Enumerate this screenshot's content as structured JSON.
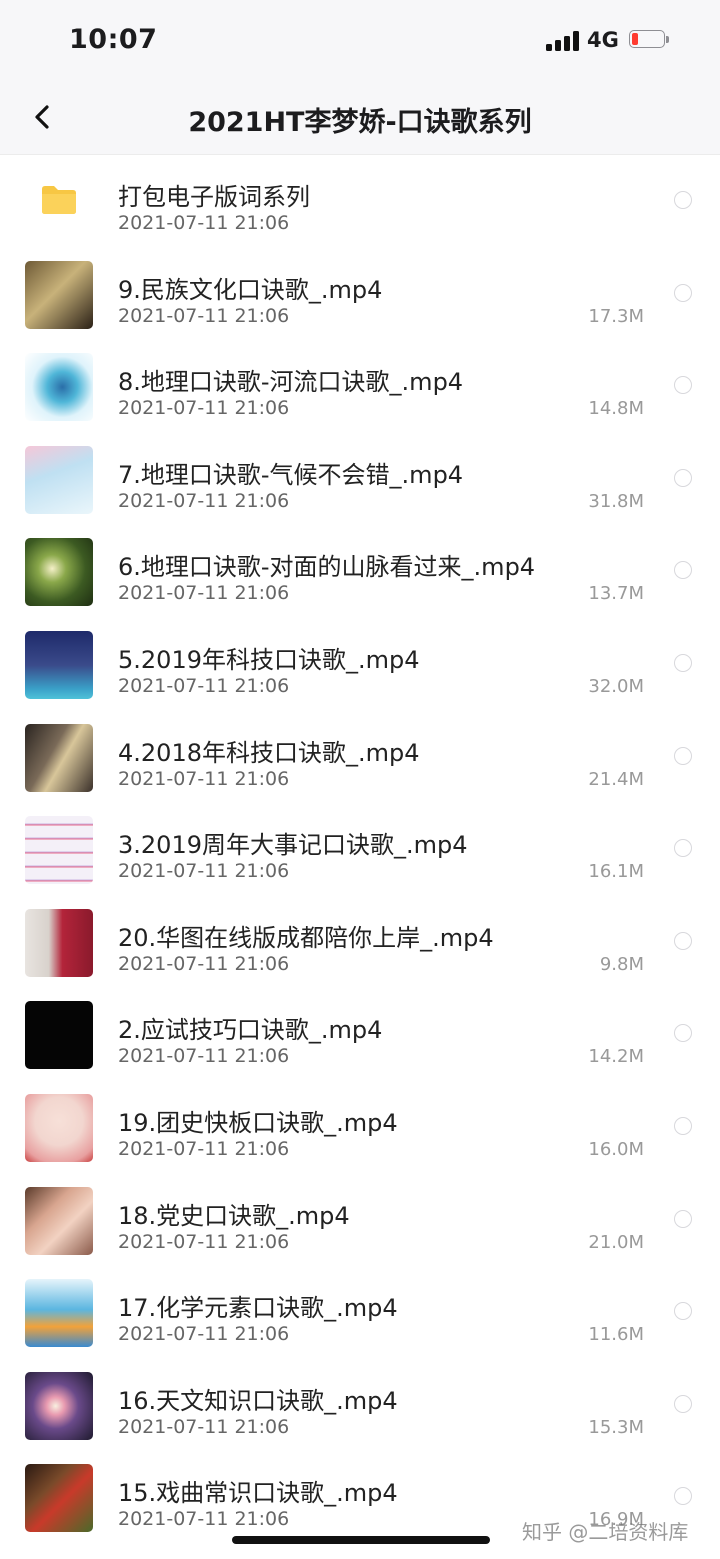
{
  "status": {
    "time": "10:07",
    "network": "4G"
  },
  "nav": {
    "title": "2021HT李梦娇-口诀歌系列"
  },
  "items": [
    {
      "name": "打包电子版词系列",
      "date": "2021-07-11 21:06",
      "size": "",
      "type": "folder-icon"
    },
    {
      "name": "9.民族文化口诀歌_.mp4",
      "date": "2021-07-11 21:06",
      "size": "17.3M",
      "thumb": "#6e5a36"
    },
    {
      "name": "8.地理口诀歌-河流口诀歌_.mp4",
      "date": "2021-07-11 21:06",
      "size": "14.8M",
      "thumb": "#4fb6d8"
    },
    {
      "name": "7.地理口诀歌-气候不会错_.mp4",
      "date": "2021-07-11 21:06",
      "size": "31.8M",
      "thumb": "#bfe0f2"
    },
    {
      "name": "6.地理口诀歌-对面的山脉看过来_.mp4",
      "date": "2021-07-11 21:06",
      "size": "13.7M",
      "thumb": "#5a7a33"
    },
    {
      "name": "5.2019年科技口诀歌_.mp4",
      "date": "2021-07-11 21:06",
      "size": "32.0M",
      "thumb": "#3a4a8a"
    },
    {
      "name": "4.2018年科技口诀歌_.mp4",
      "date": "2021-07-11 21:06",
      "size": "21.4M",
      "thumb": "#4a3f36"
    },
    {
      "name": "3.2019周年大事记口诀歌_.mp4",
      "date": "2021-07-11 21:06",
      "size": "16.1M",
      "thumb": "#d9c8e6"
    },
    {
      "name": "20.华图在线版成都陪你上岸_.mp4",
      "date": "2021-07-11 21:06",
      "size": "9.8M",
      "thumb": "#b3243a"
    },
    {
      "name": "2.应试技巧口诀歌_.mp4",
      "date": "2021-07-11 21:06",
      "size": "14.2M",
      "thumb": "#050505"
    },
    {
      "name": "19.团史快板口诀歌_.mp4",
      "date": "2021-07-11 21:06",
      "size": "16.0M",
      "thumb": "#f2d6cf"
    },
    {
      "name": "18.党史口诀歌_.mp4",
      "date": "2021-07-11 21:06",
      "size": "21.0M",
      "thumb": "#d8a58f"
    },
    {
      "name": "17.化学元素口诀歌_.mp4",
      "date": "2021-07-11 21:06",
      "size": "11.6M",
      "thumb": "#5bb6e0"
    },
    {
      "name": "16.天文知识口诀歌_.mp4",
      "date": "2021-07-11 21:06",
      "size": "15.3M",
      "thumb": "#3b2a3a"
    },
    {
      "name": "15.戏曲常识口诀歌_.mp4",
      "date": "2021-07-11 21:06",
      "size": "16.9M",
      "thumb": "#7a4a2a"
    }
  ],
  "watermark": "知乎 @二培资料库"
}
